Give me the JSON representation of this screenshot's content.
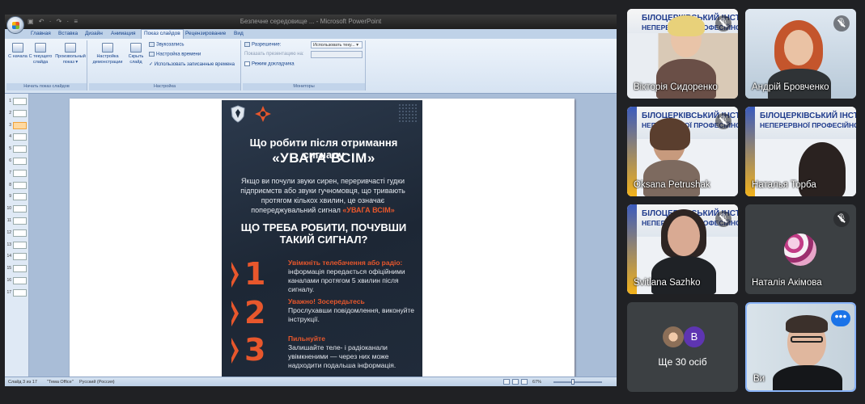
{
  "ppt": {
    "window_title": "Безпечне середовище ... - Microsoft PowerPoint",
    "qat": "▣ ↶ · ↷ · ≡",
    "tabs": [
      "Главная",
      "Вставка",
      "Дизайн",
      "Анимация",
      "Показ слайдов",
      "Рецензирование",
      "Вид"
    ],
    "active_tab": "Показ слайдов",
    "ribbon": {
      "groups": [
        "Начать показ слайдов",
        "Настройка",
        "Мониторы"
      ],
      "btn_from_start": "С начала",
      "btn_from_current": "С текущего слайда",
      "btn_custom_show": "Произвольный показ ▾",
      "btn_setup": "Настройка демонстрации",
      "btn_hide": "Скрыть слайд",
      "opt_sound": "Звукозапись",
      "opt_timing": "Настройка времени",
      "opt_recorded": "Использовать записанные времена",
      "mon_resolution_label": "Разрешение:",
      "mon_resolution_value": "Использовать теку... ▾",
      "mon_show_on": "Показать презентацию на:",
      "mon_presenter": "Режим докладчика"
    },
    "thumbnails": [
      "1",
      "2",
      "3",
      "4",
      "5",
      "6",
      "7",
      "8",
      "9",
      "10",
      "11",
      "12",
      "13",
      "14",
      "15",
      "16",
      "17"
    ],
    "selected_slide": "3",
    "status": {
      "slide": "Слайд 3 из 17",
      "theme": "\"Тема Office\"",
      "lang": "Русский (Россия)",
      "zoom": "67%"
    }
  },
  "poster": {
    "title_line1": "Що робити після отримання сигналу",
    "title_line2": "«УВАГА ВСІМ»",
    "intro": "Якщо ви почули звуки сирен, переривчасті гудки підприємств або звуки гучномовця, що тривають протягом кількох хвилин, це означає попереджувальний сигнал",
    "intro_accent": "«УВАГА ВСІМ»",
    "question": "ЩО ТРЕБА РОБИТИ, ПОЧУВШИ ТАКИЙ СИГНАЛ?",
    "steps": [
      {
        "num": "1",
        "title": "Увімкніть телебачення або радіо:",
        "text": "інформація передається офіційними каналами протягом 5 хвилин після сигналу."
      },
      {
        "num": "2",
        "title": "Уважно! Зосередьтесь",
        "text": "Прослухавши повідомлення, виконуйте інструкції."
      },
      {
        "num": "3",
        "title": "Пильнуйте",
        "text": "Залишайте теле- і радіоканали увімкненими — через них може надходити подальша інформація."
      }
    ],
    "accent_color": "#e8572c"
  },
  "participants": [
    {
      "name": "Вікторія Сидоренко",
      "muted": true
    },
    {
      "name": "Андрій Бровченко",
      "muted": true
    },
    {
      "name": "Oksana Petrushak",
      "muted": true
    },
    {
      "name": "Наталья Торба",
      "muted": false
    },
    {
      "name": "Svitlana Sazhko",
      "muted": true
    },
    {
      "name": "Наталія Акімова",
      "muted": true
    },
    {
      "name": "Ще 30 осіб",
      "avatar_letter": "В"
    },
    {
      "name": "Ви"
    }
  ],
  "banner": {
    "line1": "БІЛОЦЕРКІВСЬКИЙ ІНСТИ",
    "line2": "НЕПЕРЕРВНОЇ ПРОФЕСІЙНОЇ О"
  },
  "more_options": "•••"
}
